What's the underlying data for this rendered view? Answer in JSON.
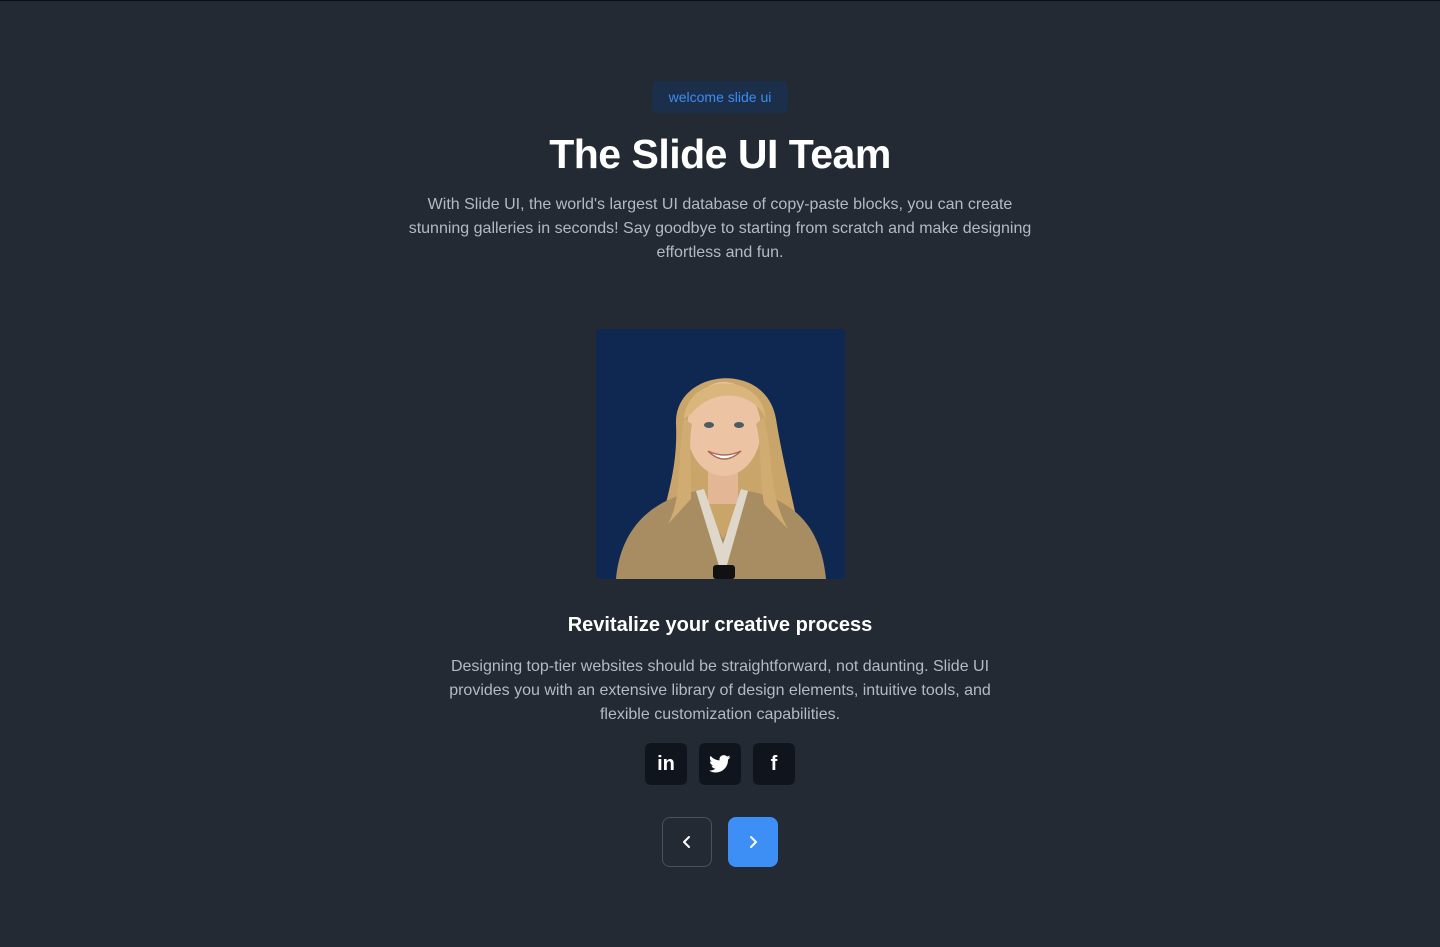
{
  "badge": {
    "label": "welcome slide ui"
  },
  "header": {
    "title": "The Slide UI Team",
    "description": "With Slide UI, the world's largest UI database of copy-paste blocks, you can create stunning galleries in seconds! Say goodbye to starting from scratch and make designing effortless and fun."
  },
  "slide": {
    "photo_icon": "team-member-photo",
    "title": "Revitalize your creative process",
    "text": "Designing top-tier websites should be straightforward, not daunting. Slide UI provides you with an extensive library of design elements, intuitive tools, and flexible customization capabilities."
  },
  "socials": [
    {
      "icon": "linkedin-icon",
      "glyph": "in"
    },
    {
      "icon": "twitter-icon"
    },
    {
      "icon": "facebook-icon",
      "glyph": "f"
    }
  ],
  "navigation": {
    "prev_icon": "chevron-left-icon",
    "next_icon": "chevron-right-icon"
  },
  "colors": {
    "background": "#242a33",
    "accent": "#3d8ff5",
    "badge_bg": "#1b2e4a",
    "photo_bg": "#0e2851"
  }
}
